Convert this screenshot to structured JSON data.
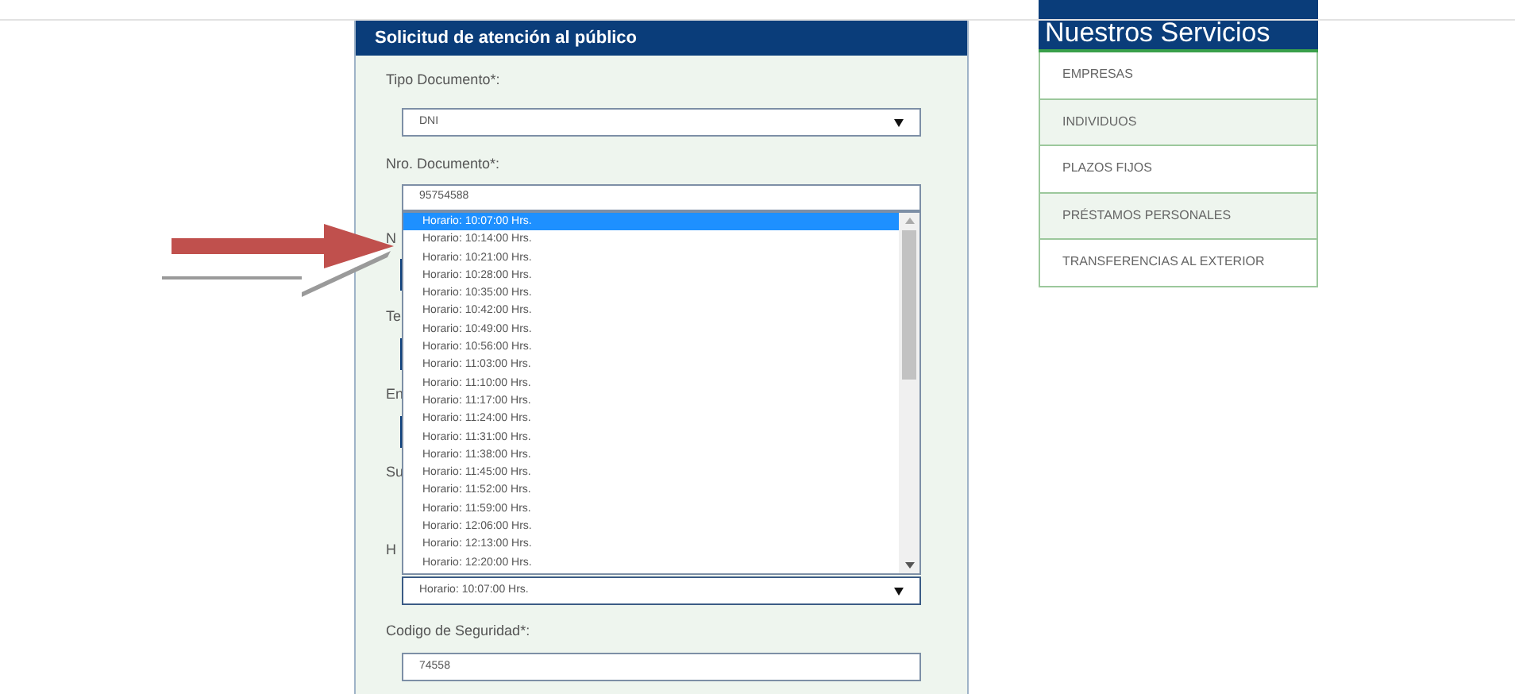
{
  "form": {
    "title": "Solicitud de atención al público",
    "tipo": {
      "label": "Tipo Documento*:",
      "value": "DNI"
    },
    "nro": {
      "label": "Nro. Documento*:",
      "value": "95754588"
    },
    "covered_labels": [
      "N",
      "Te",
      "En",
      "Su",
      "H"
    ],
    "dropdown": {
      "options": [
        {
          "label": "Horario: 10:07:00 Hrs.",
          "selected": true
        },
        {
          "label": "Horario: 10:14:00 Hrs.",
          "selected": false
        },
        {
          "label": "Horario: 10:21:00 Hrs.",
          "selected": false
        },
        {
          "label": "Horario: 10:28:00 Hrs.",
          "selected": false
        },
        {
          "label": "Horario: 10:35:00 Hrs.",
          "selected": false
        },
        {
          "label": "Horario: 10:42:00 Hrs.",
          "selected": false
        },
        {
          "label": "Horario: 10:49:00 Hrs.",
          "selected": false
        },
        {
          "label": "Horario: 10:56:00 Hrs.",
          "selected": false
        },
        {
          "label": "Horario: 11:03:00 Hrs.",
          "selected": false
        },
        {
          "label": "Horario: 11:10:00 Hrs.",
          "selected": false
        },
        {
          "label": "Horario: 11:17:00 Hrs.",
          "selected": false
        },
        {
          "label": "Horario: 11:24:00 Hrs.",
          "selected": false
        },
        {
          "label": "Horario: 11:31:00 Hrs.",
          "selected": false
        },
        {
          "label": "Horario: 11:38:00 Hrs.",
          "selected": false
        },
        {
          "label": "Horario: 11:45:00 Hrs.",
          "selected": false
        },
        {
          "label": "Horario: 11:52:00 Hrs.",
          "selected": false
        },
        {
          "label": "Horario: 11:59:00 Hrs.",
          "selected": false
        },
        {
          "label": "Horario: 12:06:00 Hrs.",
          "selected": false
        },
        {
          "label": "Horario: 12:13:00 Hrs.",
          "selected": false
        },
        {
          "label": "Horario: 12:20:00 Hrs.",
          "selected": false
        }
      ]
    },
    "horario": {
      "value": "Horario: 10:07:00 Hrs."
    },
    "codigo": {
      "label": "Codigo de Seguridad*:",
      "value": "74558"
    }
  },
  "services": {
    "title": "Nuestros Servicios",
    "items": [
      {
        "label": "EMPRESAS"
      },
      {
        "label": "INDIVIDUOS"
      },
      {
        "label": "PLAZOS FIJOS"
      },
      {
        "label": "PRÉSTAMOS PERSONALES"
      },
      {
        "label": "TRANSFERENCIAS AL EXTERIOR"
      }
    ]
  }
}
